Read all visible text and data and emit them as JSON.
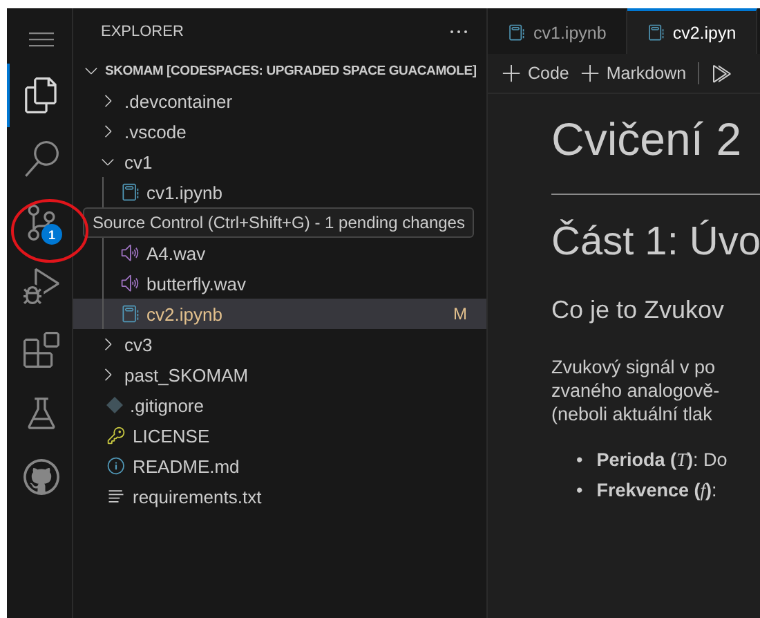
{
  "activity_bar": {
    "items": [
      {
        "kind": "menu",
        "selected": false
      },
      {
        "kind": "files",
        "selected": true
      },
      {
        "kind": "search",
        "selected": false
      },
      {
        "kind": "scm",
        "selected": false,
        "badge": "1",
        "tooltip": "Source Control (Ctrl+Shift+G) - 1 pending changes"
      },
      {
        "kind": "debug",
        "selected": false
      },
      {
        "kind": "extensions",
        "selected": false
      },
      {
        "kind": "testing",
        "selected": false
      },
      {
        "kind": "github",
        "selected": false
      }
    ]
  },
  "explorer": {
    "title": "EXPLORER",
    "root": {
      "label": "SKOMAM [CODESPACES: UPGRADED SPACE GUACAMOLE]",
      "expanded": true
    },
    "items": [
      {
        "kind": "folder",
        "label": ".devcontainer",
        "expanded": false,
        "selected": false
      },
      {
        "kind": "folder",
        "label": ".vscode",
        "expanded": false,
        "selected": false
      },
      {
        "kind": "folder",
        "label": "cv1",
        "expanded": true,
        "selected": false,
        "children": [
          {
            "kind": "notebook",
            "label": "cv1.ipynb",
            "selected": false
          },
          {
            "kind": "audio",
            "label": "A4.wav",
            "selected": false
          },
          {
            "kind": "audio",
            "label": "butterfly.wav",
            "selected": false
          },
          {
            "kind": "notebook",
            "label": "cv2.ipynb",
            "selected": true,
            "status": "M"
          }
        ]
      },
      {
        "kind": "folder",
        "label": "cv3",
        "expanded": false,
        "selected": false
      },
      {
        "kind": "folder",
        "label": "past_SKOMAM",
        "expanded": false,
        "selected": false
      },
      {
        "kind": "git",
        "label": ".gitignore",
        "selected": false
      },
      {
        "kind": "license",
        "label": "LICENSE",
        "selected": false
      },
      {
        "kind": "readme",
        "label": "README.md",
        "selected": false
      },
      {
        "kind": "text",
        "label": "requirements.txt",
        "selected": false
      }
    ]
  },
  "editor": {
    "tabs": [
      {
        "label": "cv1.ipynb",
        "selected": false
      },
      {
        "label": "cv2.ipyn",
        "selected": true
      }
    ],
    "toolbar": [
      "Code",
      "Markdown"
    ],
    "heading_1": "Cvičení 2",
    "heading_2": "Část 1: Úvo",
    "heading_3": "Co je to Zvukov",
    "paragraph": [
      "Zvukový signál v po",
      "zvaného analogově-",
      "(neboli aktuální tlak"
    ],
    "bullets": [
      {
        "marker": "•",
        "term": "Perioda (",
        "symbol": "T",
        "term_end": ")",
        "text": ": Do"
      },
      {
        "marker": "•",
        "term": "Frekvence (",
        "symbol": "f",
        "term_end": ")",
        "text": ":"
      }
    ]
  }
}
